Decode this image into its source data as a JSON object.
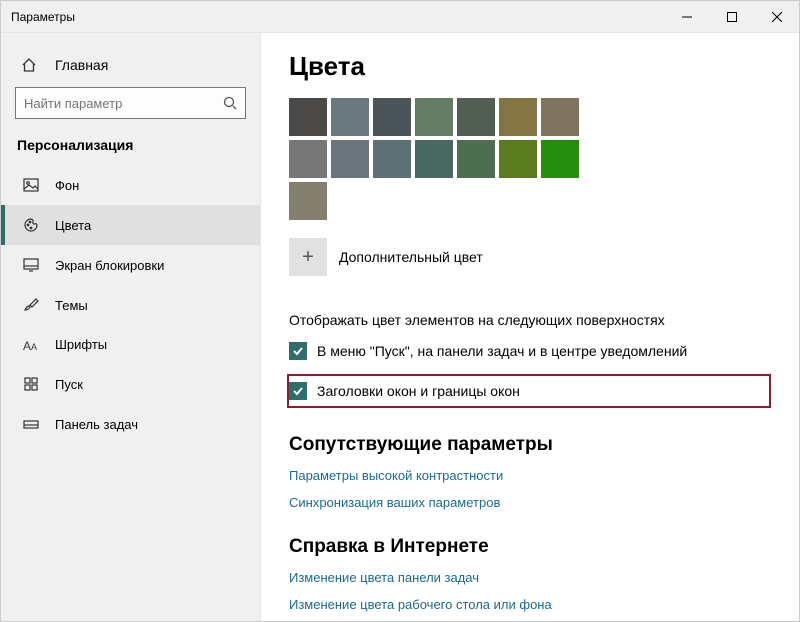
{
  "window": {
    "title": "Параметры"
  },
  "sidebar": {
    "home": "Главная",
    "search_placeholder": "Найти параметр",
    "section": "Персонализация",
    "items": [
      {
        "label": "Фон"
      },
      {
        "label": "Цвета"
      },
      {
        "label": "Экран блокировки"
      },
      {
        "label": "Темы"
      },
      {
        "label": "Шрифты"
      },
      {
        "label": "Пуск"
      },
      {
        "label": "Панель задач"
      }
    ]
  },
  "page": {
    "title": "Цвета",
    "swatches": [
      "#4c4a48",
      "#69797e",
      "#4a5459",
      "#647c64",
      "#525e54",
      "#847545",
      "#7e735f",
      "#767676",
      "#6b737b",
      "#5d7175",
      "#486860",
      "#4f6d4f",
      "#5b7b1f",
      "#258e0f",
      "#847e6e"
    ],
    "add_color": "Дополнительный цвет",
    "surface_label": "Отображать цвет элементов на следующих поверхностях",
    "checks": [
      {
        "label": "В меню \"Пуск\", на панели задач и в центре уведомлений"
      },
      {
        "label": "Заголовки окон и границы окон"
      }
    ],
    "related_title": "Сопутствующие параметры",
    "related_links": [
      "Параметры высокой контрастности",
      "Синхронизация ваших параметров"
    ],
    "help_title": "Справка в Интернете",
    "help_links": [
      "Изменение цвета панели задач",
      "Изменение цвета рабочего стола или фона"
    ]
  }
}
